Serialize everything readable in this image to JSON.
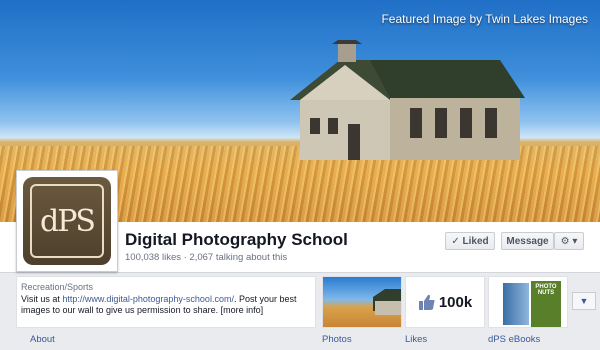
{
  "cover": {
    "credit": "Featured Image by Twin Lakes Images"
  },
  "profile": {
    "logo_text": "dPS"
  },
  "page": {
    "name": "Digital Photography School",
    "stats": "100,038 likes · 2,067 talking about this"
  },
  "actions": {
    "liked": "✓ Liked",
    "message": "Message",
    "gear": "⚙ ▾"
  },
  "about": {
    "category": "Recreation/Sports",
    "description_prefix": "Visit us at ",
    "url": "http://www.digital-photography-school.com/",
    "description_suffix": ". Post your best images to our wall to give us permission to share. [more info]"
  },
  "tiles": {
    "likes_count": "100k",
    "ebook_title": "PHOTO NUTS"
  },
  "labels": {
    "about": "About",
    "photos": "Photos",
    "likes": "Likes",
    "ebooks": "dPS eBooks"
  },
  "colors": {
    "link": "#3b5998",
    "background": "#e9ebee"
  }
}
